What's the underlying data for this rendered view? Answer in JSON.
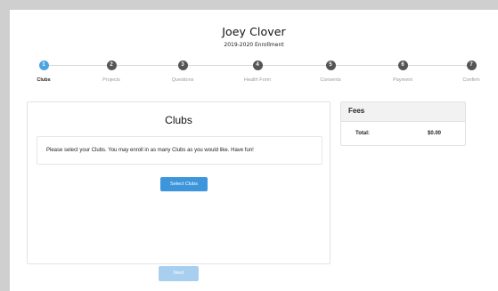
{
  "header": {
    "student_name": "Joey Clover",
    "enrollment_title": "2019-2020 Enrollment"
  },
  "steps": [
    {
      "number": "1",
      "label": "Clubs",
      "active": true
    },
    {
      "number": "2",
      "label": "Projects",
      "active": false
    },
    {
      "number": "3",
      "label": "Questions",
      "active": false
    },
    {
      "number": "4",
      "label": "Health Form",
      "active": false
    },
    {
      "number": "5",
      "label": "Consents",
      "active": false
    },
    {
      "number": "6",
      "label": "Payment",
      "active": false
    },
    {
      "number": "7",
      "label": "Confirm",
      "active": false
    }
  ],
  "clubs": {
    "title": "Clubs",
    "instructions": "Please select your Clubs. You may enroll in as many Clubs as you would like. Have fun!",
    "select_button": "Select Clubs"
  },
  "fees": {
    "title": "Fees",
    "total_label": "Total:",
    "total_value": "$0.00"
  },
  "footer": {
    "next_button": "Next"
  },
  "colors": {
    "accent": "#3d95dc",
    "active_step": "#4da3e0",
    "inactive_step": "#555555",
    "next_disabled": "#a9cff0"
  }
}
